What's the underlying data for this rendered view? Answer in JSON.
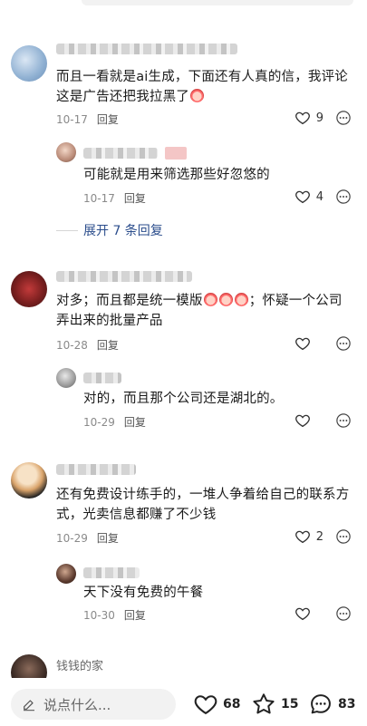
{
  "comments": [
    {
      "text": "而且一看就是ai生成，下面还有人真的信，我评论这是广告还把我拉黑了",
      "date": "10-17",
      "reply_label": "回复",
      "likes": "9",
      "replies": [
        {
          "text": "可能就是用来筛选那些好忽悠的",
          "date": "10-17",
          "reply_label": "回复",
          "likes": "4"
        }
      ],
      "expand_label": "展开 7 条回复"
    },
    {
      "text_a": "对多；而且都是统一模版",
      "text_b": "；怀疑一个公司弄出来的批量产品",
      "date": "10-28",
      "reply_label": "回复",
      "likes": "",
      "replies": [
        {
          "text": "对的，而且那个公司还是湖北的。",
          "date": "10-29",
          "reply_label": "回复",
          "likes": ""
        }
      ]
    },
    {
      "text": "还有免费设计练手的，一堆人争着给自己的联系方式，光卖信息都赚了不少钱",
      "date": "10-29",
      "reply_label": "回复",
      "likes": "2",
      "replies": [
        {
          "text": "天下没有免费的午餐",
          "date": "10-30",
          "reply_label": "回复",
          "likes": ""
        }
      ]
    },
    {
      "author": "钱钱的家"
    }
  ],
  "bottom_bar": {
    "input_placeholder": "说点什么...",
    "likes": "68",
    "favorites": "15",
    "comments": "83"
  }
}
